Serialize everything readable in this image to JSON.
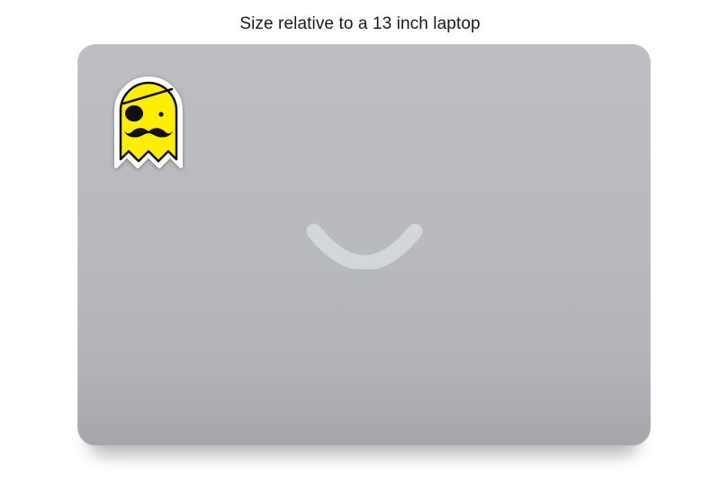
{
  "caption": "Size relative to a 13 inch laptop",
  "colors": {
    "laptop_lid": "#b9babe",
    "logo": "#d3d6da",
    "sticker_fill": "#ffee00",
    "sticker_outline": "#111111",
    "sticker_border": "#ffffff"
  },
  "sticker": {
    "icon": "pirate-ghost-icon"
  },
  "laptop": {
    "logo_icon": "smile-logo-icon"
  }
}
